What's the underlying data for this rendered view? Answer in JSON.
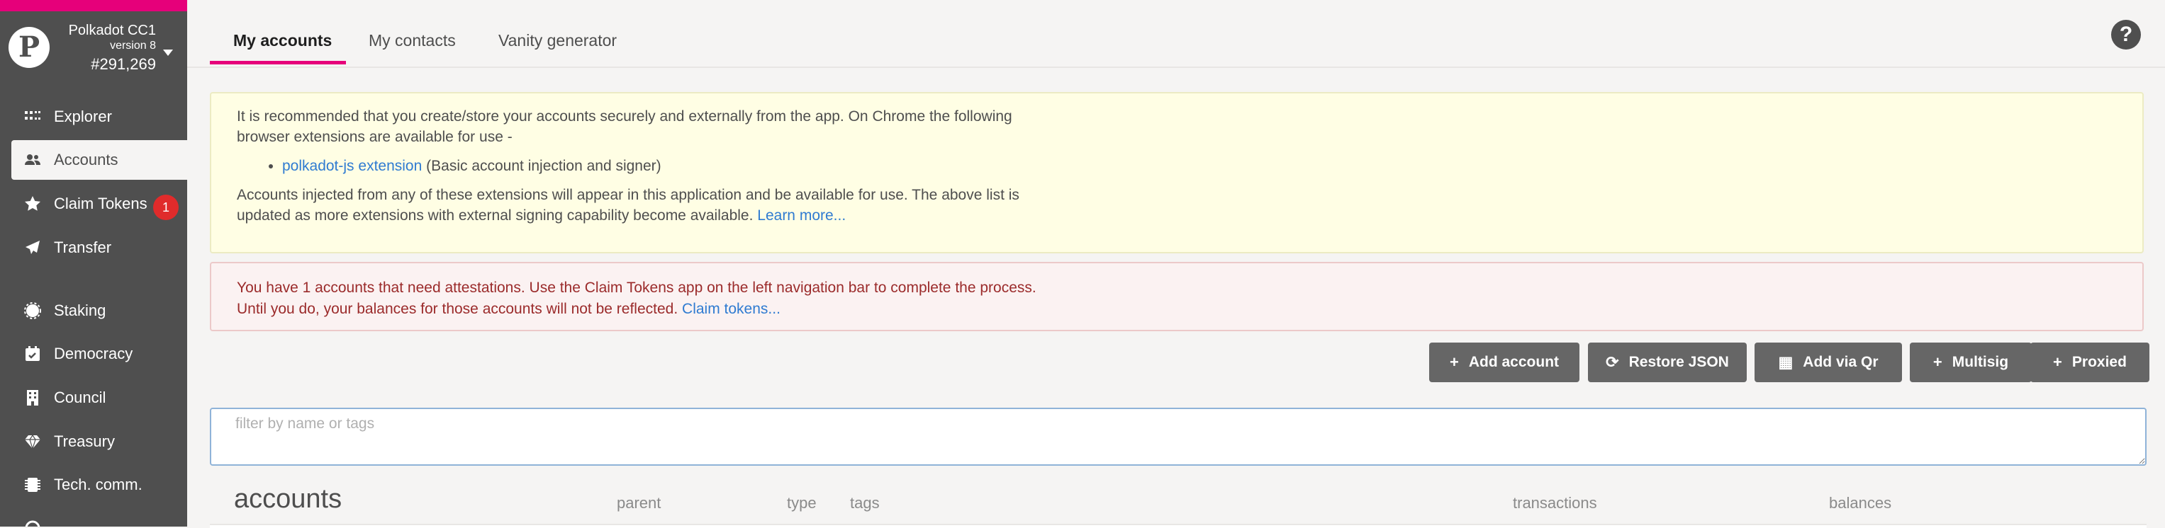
{
  "chain": {
    "name": "Polkadot CC1",
    "version": "version 8",
    "block": "#291,269",
    "logo_letter": "P",
    "accent_color": "#e6007a"
  },
  "sidebar": {
    "items": [
      {
        "label": "Explorer",
        "icon": "explorer-icon"
      },
      {
        "label": "Accounts",
        "icon": "users-icon",
        "active": true
      },
      {
        "label": "Claim Tokens",
        "icon": "star-icon",
        "badge": "1"
      },
      {
        "label": "Transfer",
        "icon": "paper-plane-icon"
      },
      {
        "label": "Staking",
        "icon": "certificate-icon"
      },
      {
        "label": "Democracy",
        "icon": "calendar-check-icon"
      },
      {
        "label": "Council",
        "icon": "building-icon"
      },
      {
        "label": "Treasury",
        "icon": "gem-icon"
      },
      {
        "label": "Tech. comm.",
        "icon": "microchip-icon"
      }
    ]
  },
  "tabs": [
    {
      "label": "My accounts",
      "active": true
    },
    {
      "label": "My contacts"
    },
    {
      "label": "Vanity generator"
    }
  ],
  "help": {
    "label": "?"
  },
  "info_box": {
    "intro": "It is recommended that you create/store your accounts securely and externally from the app. On Chrome the following browser extensions are available for use -",
    "extension_link": "polkadot-js extension",
    "extension_desc": "(Basic account injection and signer)",
    "outro": "Accounts injected from any of these extensions will appear in this application and be available for use. The above list is updated as more extensions with external signing capability become available.",
    "learn_more": "Learn more..."
  },
  "warning_box": {
    "text": "You have 1 accounts that need attestations. Use the Claim Tokens app on the left navigation bar to complete the process. Until you do, your balances for those accounts will not be reflected.",
    "link": "Claim tokens..."
  },
  "actions": [
    {
      "label": "Add account",
      "icon": "plus-icon",
      "glyph": "+"
    },
    {
      "label": "Restore JSON",
      "icon": "sync-icon",
      "glyph": "⟳"
    },
    {
      "label": "Add via Qr",
      "icon": "qrcode-icon",
      "glyph": "▦"
    },
    {
      "label": "Multisig",
      "icon": "plus-icon",
      "glyph": "+"
    },
    {
      "label": "Proxied",
      "icon": "plus-icon",
      "glyph": "+"
    }
  ],
  "filter": {
    "placeholder": "filter by name or tags",
    "value": ""
  },
  "table": {
    "title": "accounts",
    "headers": [
      "parent",
      "type",
      "tags",
      "transactions",
      "balances"
    ]
  }
}
